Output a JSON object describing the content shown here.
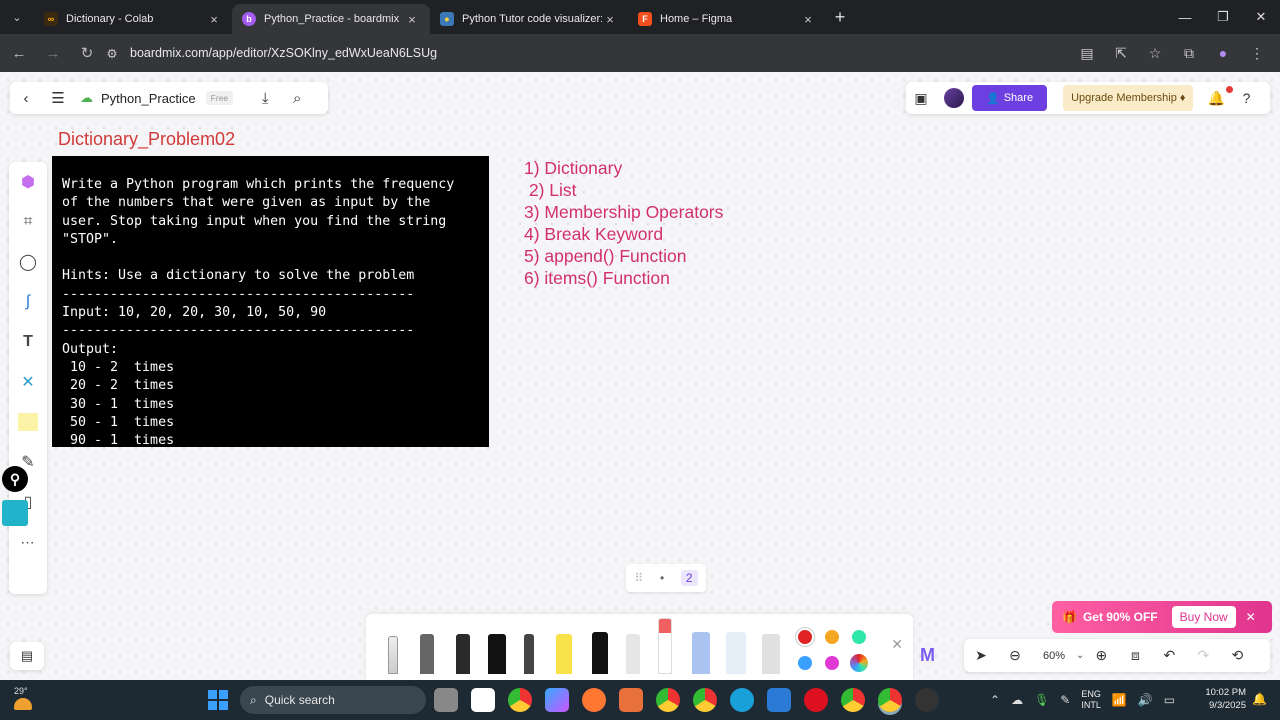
{
  "browser": {
    "tabs": [
      {
        "title": "Dictionary - Colab",
        "icon": "colab-icon",
        "color": "#f9ab00"
      },
      {
        "title": "Python_Practice - boardmix",
        "icon": "boardmix-icon",
        "color": "#a45cf0"
      },
      {
        "title": "Python Tutor code visualizer: Vi",
        "icon": "python-icon",
        "color": "#3a78b8"
      },
      {
        "title": "Home – Figma",
        "icon": "figma-icon",
        "color": "#f24e1e"
      }
    ],
    "url": "boardmix.com/app/editor/XzSOKlny_edWxUeaN6LSUg"
  },
  "board": {
    "title": "Python_Practice",
    "plan_badge": "Free",
    "share_label": "Share",
    "upgrade_label": "Upgrade Membership",
    "notification_count": "1"
  },
  "content": {
    "frame_title": "Dictionary_Problem02",
    "code_text": "Write a Python program which prints the frequency\nof the numbers that were given as input by the\nuser. Stop taking input when you find the string\n\"STOP\".\n\nHints: Use a dictionary to solve the problem\n--------------------------------------------\nInput: 10, 20, 20, 30, 10, 50, 90\n--------------------------------------------\nOutput:\n 10 - 2  times\n 20 - 2  times\n 30 - 1  times\n 50 - 1  times\n 90 - 1  times",
    "topics": [
      "1) Dictionary",
      " 2) List",
      "3) Membership Operators",
      "4) Break Keyword",
      "5) append() Function",
      "6) items() Function"
    ]
  },
  "toolbar": {
    "zoom": "60%",
    "mini_sel": "2"
  },
  "promo": {
    "text": "Get 90% OFF",
    "buy_label": "Buy Now"
  },
  "taskbar": {
    "temperature": "29°",
    "search_placeholder": "Quick search",
    "lang_line1": "ENG",
    "lang_line2": "INTL",
    "time": "10:02 PM",
    "date": "9/3/2025"
  },
  "colors": {
    "accent": "#6c3fe0",
    "title_red": "#d23a3a",
    "topic_pink": "#d2306b",
    "swatches": [
      "#e02424",
      "#f5a623",
      "#2ee6a8",
      "#3aa0ff",
      "#e03ad6",
      "#9b59b6"
    ]
  }
}
